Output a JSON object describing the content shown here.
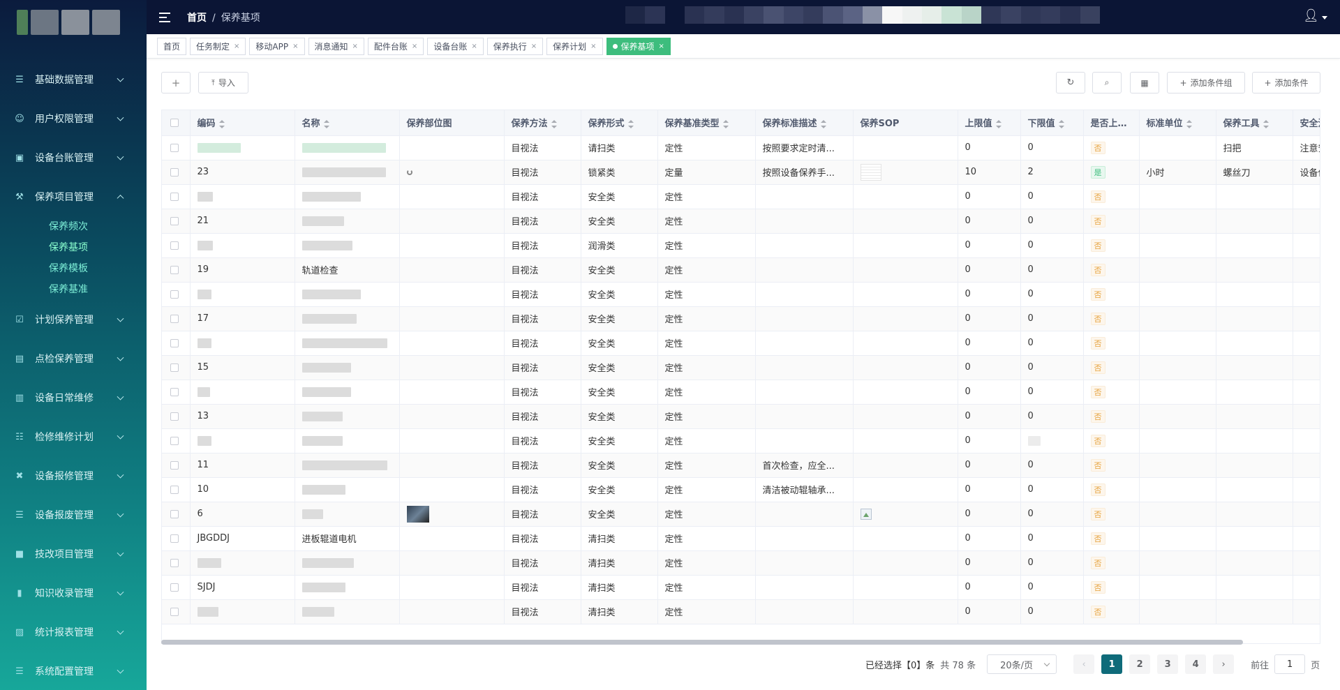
{
  "brand": {
    "colors": {
      "accent": "#3dbd7d",
      "page_active": "#0f6b7a",
      "header_bg": "#0b1535"
    }
  },
  "header": {
    "breadcrumb_home": "首页",
    "breadcrumb_sep": "/",
    "breadcrumb_current": "保养基项"
  },
  "sidebar": {
    "items": [
      {
        "label": "基础数据管理",
        "icon": "list-icon"
      },
      {
        "label": "用户权限管理",
        "icon": "user-icon"
      },
      {
        "label": "设备台账管理",
        "icon": "monitor-icon"
      },
      {
        "label": "保养项目管理",
        "icon": "tool-icon"
      },
      {
        "label": "计划保养管理",
        "icon": "calendar-check-icon"
      },
      {
        "label": "点检保养管理",
        "icon": "chart-icon"
      },
      {
        "label": "设备日常维修",
        "icon": "clipboard-icon"
      },
      {
        "label": "检修维修计划",
        "icon": "sitemap-icon"
      },
      {
        "label": "设备报修管理",
        "icon": "wrench-icon"
      },
      {
        "label": "设备报废管理",
        "icon": "document-icon"
      },
      {
        "label": "技改项目管理",
        "icon": "briefcase-icon"
      },
      {
        "label": "知识收录管理",
        "icon": "knowledge-icon"
      },
      {
        "label": "统计报表管理",
        "icon": "report-icon"
      },
      {
        "label": "系统配置管理",
        "icon": "settings-list-icon"
      }
    ],
    "submenu": [
      "保养频次",
      "保养基项",
      "保养模板",
      "保养基准"
    ]
  },
  "tabs": [
    {
      "label": "首页",
      "closable": false
    },
    {
      "label": "任务制定",
      "closable": true
    },
    {
      "label": "移动APP",
      "closable": true
    },
    {
      "label": "消息通知",
      "closable": true
    },
    {
      "label": "配件台账",
      "closable": true
    },
    {
      "label": "设备台账",
      "closable": true
    },
    {
      "label": "保养执行",
      "closable": true
    },
    {
      "label": "保养计划",
      "closable": true
    },
    {
      "label": "保养基项",
      "closable": true,
      "active": true
    }
  ],
  "toolbar": {
    "add_label": "+",
    "import_label": "导入",
    "add_condition_group": "添加条件组",
    "add_condition": "添加条件"
  },
  "table": {
    "columns": [
      "编码",
      "名称",
      "保养部位图",
      "保养方法",
      "保养形式",
      "保养基准类型",
      "保养标准描述",
      "保养SOP",
      "上限值",
      "下限值",
      "是否上传保",
      "标准单位",
      "保养工具",
      "安全注意"
    ],
    "rows": [
      {
        "code": "",
        "name": "",
        "method": "目视法",
        "form": "请扫类",
        "type": "定性",
        "desc": "按照要求定时清...",
        "upper": "0",
        "lower": "0",
        "upload": "否",
        "unit": "",
        "tool": "扫把",
        "safety": "注意安全"
      },
      {
        "code": "23",
        "name": "",
        "method": "目视法",
        "form": "锁紧类",
        "type": "定量",
        "desc": "按照设备保养手...",
        "upper": "10",
        "lower": "2",
        "upload": "是",
        "unit": "小时",
        "tool": "螺丝刀",
        "safety": "设备停机"
      },
      {
        "code": "",
        "name": "",
        "method": "目视法",
        "form": "安全类",
        "type": "定性",
        "desc": "",
        "upper": "0",
        "lower": "0",
        "upload": "否",
        "unit": "",
        "tool": "",
        "safety": ""
      },
      {
        "code": "21",
        "name": "",
        "method": "目视法",
        "form": "安全类",
        "type": "定性",
        "desc": "",
        "upper": "0",
        "lower": "0",
        "upload": "否",
        "unit": "",
        "tool": "",
        "safety": ""
      },
      {
        "code": "",
        "name": "",
        "method": "目视法",
        "form": "润滑类",
        "type": "定性",
        "desc": "",
        "upper": "0",
        "lower": "0",
        "upload": "否",
        "unit": "",
        "tool": "",
        "safety": ""
      },
      {
        "code": "19",
        "name": "轨道检查",
        "method": "目视法",
        "form": "安全类",
        "type": "定性",
        "desc": "",
        "upper": "0",
        "lower": "0",
        "upload": "否",
        "unit": "",
        "tool": "",
        "safety": ""
      },
      {
        "code": "",
        "name": "",
        "method": "目视法",
        "form": "安全类",
        "type": "定性",
        "desc": "",
        "upper": "0",
        "lower": "0",
        "upload": "否",
        "unit": "",
        "tool": "",
        "safety": ""
      },
      {
        "code": "17",
        "name": "",
        "method": "目视法",
        "form": "安全类",
        "type": "定性",
        "desc": "",
        "upper": "0",
        "lower": "0",
        "upload": "否",
        "unit": "",
        "tool": "",
        "safety": ""
      },
      {
        "code": "",
        "name": "",
        "method": "目视法",
        "form": "安全类",
        "type": "定性",
        "desc": "",
        "upper": "0",
        "lower": "0",
        "upload": "否",
        "unit": "",
        "tool": "",
        "safety": ""
      },
      {
        "code": "15",
        "name": "",
        "method": "目视法",
        "form": "安全类",
        "type": "定性",
        "desc": "",
        "upper": "0",
        "lower": "0",
        "upload": "否",
        "unit": "",
        "tool": "",
        "safety": ""
      },
      {
        "code": "",
        "name": "",
        "method": "目视法",
        "form": "安全类",
        "type": "定性",
        "desc": "",
        "upper": "0",
        "lower": "0",
        "upload": "否",
        "unit": "",
        "tool": "",
        "safety": ""
      },
      {
        "code": "13",
        "name": "",
        "method": "目视法",
        "form": "安全类",
        "type": "定性",
        "desc": "",
        "upper": "0",
        "lower": "0",
        "upload": "否",
        "unit": "",
        "tool": "",
        "safety": ""
      },
      {
        "code": "",
        "name": "",
        "method": "目视法",
        "form": "安全类",
        "type": "定性",
        "desc": "",
        "upper": "0",
        "lower": "",
        "upload": "否",
        "unit": "",
        "tool": "",
        "safety": ""
      },
      {
        "code": "11",
        "name": "",
        "method": "目视法",
        "form": "安全类",
        "type": "定性",
        "desc": "首次检查，应全...",
        "upper": "0",
        "lower": "0",
        "upload": "否",
        "unit": "",
        "tool": "",
        "safety": ""
      },
      {
        "code": "10",
        "name": "",
        "method": "目视法",
        "form": "安全类",
        "type": "定性",
        "desc": "清洁被动辊轴承...",
        "upper": "0",
        "lower": "0",
        "upload": "否",
        "unit": "",
        "tool": "",
        "safety": ""
      },
      {
        "code": "6",
        "name": "",
        "method": "目视法",
        "form": "安全类",
        "type": "定性",
        "desc": "",
        "upper": "0",
        "lower": "0",
        "upload": "否",
        "unit": "",
        "tool": "",
        "safety": ""
      },
      {
        "code": "JBGDDJ",
        "name": "进板辊道电机",
        "method": "目视法",
        "form": "清扫类",
        "type": "定性",
        "desc": "",
        "upper": "0",
        "lower": "0",
        "upload": "否",
        "unit": "",
        "tool": "",
        "safety": ""
      },
      {
        "code": "",
        "name": "",
        "method": "目视法",
        "form": "清扫类",
        "type": "定性",
        "desc": "",
        "upper": "0",
        "lower": "0",
        "upload": "否",
        "unit": "",
        "tool": "",
        "safety": ""
      },
      {
        "code": "SJDJ",
        "name": "",
        "method": "目视法",
        "form": "清扫类",
        "type": "定性",
        "desc": "",
        "upper": "0",
        "lower": "0",
        "upload": "否",
        "unit": "",
        "tool": "",
        "safety": ""
      },
      {
        "code": "",
        "name": "",
        "method": "目视法",
        "form": "清扫类",
        "type": "定性",
        "desc": "",
        "upper": "0",
        "lower": "0",
        "upload": "否",
        "unit": "",
        "tool": "",
        "safety": ""
      }
    ]
  },
  "pagination": {
    "selected_text": "已经选择【0】条",
    "total_text": "共 78 条",
    "page_size": "20条/页",
    "pages": [
      "1",
      "2",
      "3",
      "4"
    ],
    "current_page": "1",
    "goto_label": "前往",
    "goto_value": "1",
    "goto_suffix": "页"
  }
}
